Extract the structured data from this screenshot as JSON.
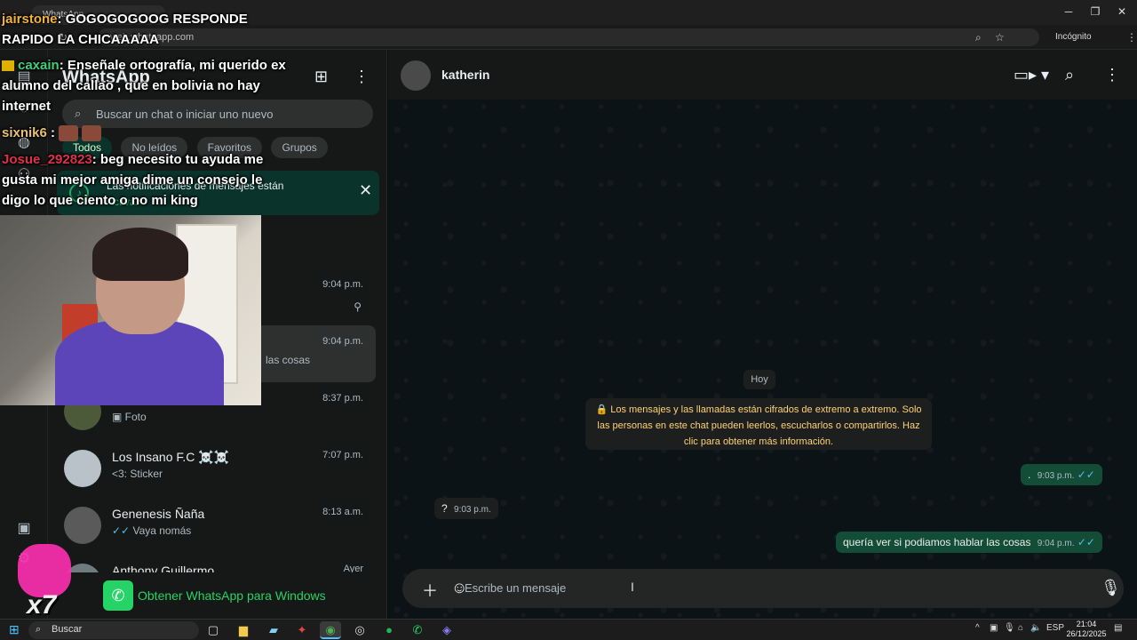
{
  "browser": {
    "tab_title": "WhatsApp",
    "url": "web.whatsapp.com",
    "incognito_label": "Incógnito",
    "win_min": "─",
    "win_max": "❐",
    "win_close": "✕"
  },
  "sidebar": {
    "app_title": "WhatsApp",
    "search_placeholder": "Buscar un chat o iniciar uno nuevo",
    "filters": [
      "Todos",
      "No leídos",
      "Favoritos",
      "Grupos"
    ],
    "notification": {
      "text": "Las notificaciones de mensajes están",
      "link": "Activar"
    },
    "chats": [
      {
        "name": "",
        "preview": "",
        "time": "9:04 p.m."
      },
      {
        "name": "",
        "preview": "las cosas",
        "time": "9:04 p.m."
      },
      {
        "name": "",
        "preview": "Foto",
        "time": "8:37 p.m."
      },
      {
        "name": "Los Insano F.C ☠️☠️",
        "preview": "<3: Sticker",
        "time": "7:07 p.m."
      },
      {
        "name": "Genenesis Ñaña",
        "preview": "Vaya nomás",
        "time": "8:13 a.m."
      },
      {
        "name": "Anthony Guillermo",
        "preview": "",
        "time": "Ayer"
      }
    ],
    "cta": "Obtener WhatsApp para Windows"
  },
  "conversation": {
    "contact_name": "katherin",
    "day_label": "Hoy",
    "encryption_notice": "Los mensajes y las llamadas están cifrados de extremo a extremo. Solo las personas en este chat pueden leerlos, escucharlos o compartirlos. Haz clic para obtener más información.",
    "messages": [
      {
        "dir": "out",
        "text": ".",
        "time": "9:03 p.m."
      },
      {
        "dir": "in",
        "text": "?",
        "time": "9:03 p.m."
      },
      {
        "dir": "out",
        "text": "quería ver si podiamos hablar las cosas",
        "time": "9:04 p.m."
      }
    ],
    "composer_placeholder": "Escribe un mensaje"
  },
  "stream_chat": [
    {
      "user": "jairstone",
      "text": ": GOGOGOGOOG RESPONDE RAPIDO LA CHICAAAAA",
      "color": "#f0b43c"
    },
    {
      "user": "caxain",
      "text": ": Enseñale ortografía, mi querido ex alumno del callao , que en bolivia no hay internet",
      "color": "#3fd07a"
    },
    {
      "user": "sixnik6",
      "text": " :",
      "color": "#e8c070"
    },
    {
      "user": "Josue_292823",
      "text": ": beg necesito tu ayuda me gusta mi mejor amiga dime un consejo le digo lo que ciento o no mi king",
      "color": "#e0304a"
    }
  ],
  "stream_sticker": "x7",
  "taskbar": {
    "search_label": "Buscar",
    "language": "ESP",
    "time": "21:04",
    "date": "26/12/2025"
  },
  "colors": {
    "accent": "#25d366",
    "outgoing_bubble": "#144d37",
    "header_bg": "#161717"
  }
}
